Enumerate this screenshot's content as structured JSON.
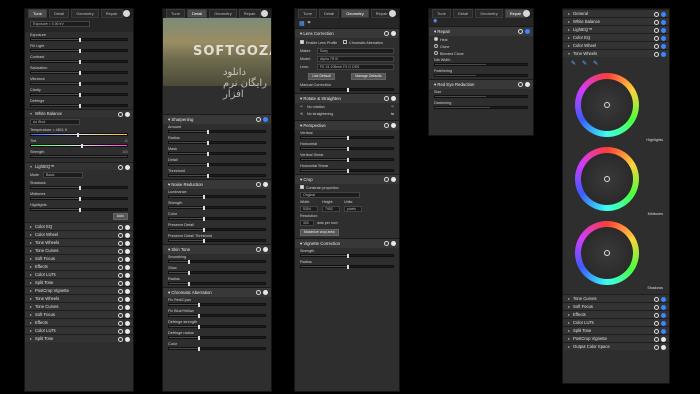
{
  "tabs": [
    "Tune",
    "Detail",
    "Geometry",
    "Repair"
  ],
  "watermark": {
    "line1": "SOFTGOZAR.COM",
    "line2": "دانلود رایگان نرم افزار"
  },
  "p1": {
    "exposure_label": "Exposure = 0.00 eV",
    "sliders": [
      "Exposure",
      "Fill Light",
      "Contrast",
      "Saturation",
      "Vibrance",
      "Clarity",
      "Defringe"
    ],
    "wb": {
      "title": "White Balance",
      "preset": "As Shot",
      "temp_label": "Temperature = 4811 K",
      "tint": "Tint",
      "strength": "Strength",
      "temp_val": "4811",
      "tint_val": "11",
      "strength_val": "100"
    },
    "lighteq": {
      "title": "LightEQ™",
      "mode_label": "Mode",
      "mode": "Basic",
      "sliders": [
        "Shadows",
        "Midtones",
        "Highlights"
      ],
      "auto": "Auto"
    },
    "sections": [
      "Color EQ",
      "Color Wheel",
      "Tone Wheels",
      "Tone Curves",
      "Soft Focus",
      "Effects",
      "Color LUTs",
      "Split Tone",
      "PostCrop Vignette",
      "Tone Wheels",
      "Tone Curves",
      "Soft Focus",
      "Effects",
      "Color LUTs",
      "Split Tone"
    ]
  },
  "p2": {
    "sharpening": {
      "title": "Sharpening",
      "rows": [
        "Amount",
        "Radius",
        "Mask",
        "Detail",
        "Threshold"
      ],
      "vals": [
        "",
        "",
        "",
        "",
        ""
      ]
    },
    "noise": {
      "title": "Noise Reduction",
      "rows": [
        "Luminance",
        "Strength",
        "Color",
        "Preserve Detail",
        "Preserve Detail Threshold"
      ]
    },
    "skin": {
      "title": "Skin Tone",
      "rows": [
        "Smoothing",
        "Glow",
        "Radius"
      ]
    },
    "aberr": {
      "title": "Chromatic Aberration",
      "rows": [
        "Fix Red/Cyan",
        "Fix Blue/Yellow",
        "Defringe strength",
        "Defringe radius",
        "Color"
      ]
    }
  },
  "p3": {
    "lens": {
      "title": "Lens Correction",
      "enable": "Enable Lens Profile",
      "ca": "Chromatic Aberration",
      "maker_label": "Maker:",
      "maker": "Sony",
      "model_label": "Model:",
      "model": "Alpha 7R III",
      "lens_label": "Lens:",
      "lens": "FE 24-105mm F4 G OSS",
      "btn1": "Use Default",
      "btn2": "Manage Defaults",
      "manual": "Manual Correction"
    },
    "rotate": {
      "title": "Rotate & Straighten",
      "no_rotation": "No rotation",
      "no_straightening": "No straightening"
    },
    "persp": {
      "title": "Perspective",
      "rows": [
        "Vertical",
        "Horizontal",
        "Vertical Shear",
        "Horizontal Shear"
      ]
    },
    "crop": {
      "title": "Crop",
      "constrain": "Constrain proportion",
      "original": "Original",
      "width_label": "Width:",
      "height_label": "Height:",
      "units_label": "Units:",
      "width": "5304",
      "height": "7952",
      "units": "pixels",
      "resolution_label": "Resolution:",
      "resolution": "300",
      "res_unit": "dots per inch",
      "maximize": "Maximize crop area"
    },
    "vignette": {
      "title": "Vignette Correction",
      "rows": [
        "Strength",
        "Radius"
      ]
    }
  },
  "p4": {
    "repair": {
      "title": "Repair",
      "opts": [
        "Heal",
        "Clone",
        "Blended Clone"
      ],
      "nib": "Nib Width",
      "feather": "Feathering"
    },
    "redeye": {
      "title": "Red Eye Reduction",
      "rows": [
        "Size",
        "Darkening"
      ]
    }
  },
  "p5": {
    "top": [
      "General",
      "White Balance",
      "LightEQ™",
      "Color EQ",
      "Color Wheel"
    ],
    "tonewheels": "Tone Wheels",
    "wheel_labels": [
      "Highlights",
      "Midtones",
      "Shadows"
    ],
    "bottom": [
      "Tone Curves",
      "Soft Focus",
      "Effects",
      "Color LUTs",
      "Split Tone",
      "PostCrop Vignette",
      "Output Color Space"
    ]
  }
}
